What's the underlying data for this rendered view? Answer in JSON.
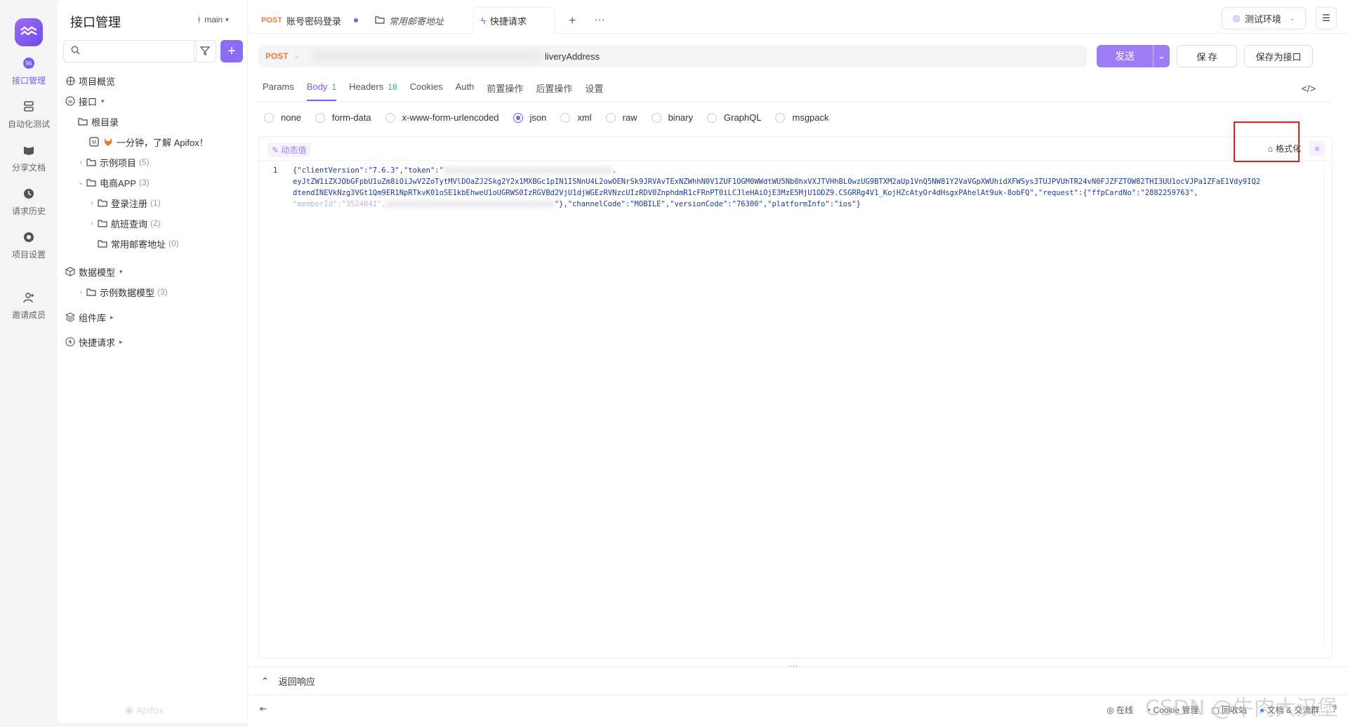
{
  "rail": {
    "items": [
      {
        "label": "接口管理",
        "icon": "api-icon"
      },
      {
        "label": "自动化测试",
        "icon": "automation-icon"
      },
      {
        "label": "分享文档",
        "icon": "book-icon"
      },
      {
        "label": "请求历史",
        "icon": "clock-icon"
      },
      {
        "label": "项目设置",
        "icon": "settings-icon"
      },
      {
        "label": "邀请成员",
        "icon": "add-user-icon"
      }
    ]
  },
  "sidebar": {
    "title": "接口管理",
    "branch": "main",
    "search_placeholder": "",
    "tree": [
      {
        "label": "项目概览"
      },
      {
        "label": "接口"
      },
      {
        "label": "根目录"
      },
      {
        "label": "一分钟，了解 Apifox！"
      },
      {
        "label": "示例项目",
        "count": "(5)"
      },
      {
        "label": "电商APP",
        "count": "(3)"
      },
      {
        "label": "登录注册",
        "count": "(1)"
      },
      {
        "label": "航班查询",
        "count": "(2)"
      },
      {
        "label": "常用邮寄地址",
        "count": "(0)"
      },
      {
        "label": "数据模型"
      },
      {
        "label": "示例数据模型",
        "count": "(3)"
      },
      {
        "label": "组件库"
      },
      {
        "label": "快捷请求"
      }
    ],
    "footer": "Apifox"
  },
  "tabs": [
    {
      "method": "POST",
      "label": "账号密码登录"
    },
    {
      "label": "常用邮寄地址"
    },
    {
      "label": "快捷请求"
    }
  ],
  "env": "测试环境",
  "request": {
    "method": "POST",
    "url_visible": "liveryAddress",
    "send": "发送",
    "save": "保 存",
    "save_as": "保存为接口"
  },
  "req_tabs": [
    {
      "label": "Params"
    },
    {
      "label": "Body",
      "badge": "1"
    },
    {
      "label": "Headers",
      "badge": "18"
    },
    {
      "label": "Cookies"
    },
    {
      "label": "Auth"
    },
    {
      "label": "前置操作"
    },
    {
      "label": "后置操作"
    },
    {
      "label": "设置"
    }
  ],
  "body_types": [
    "none",
    "form-data",
    "x-www-form-urlencoded",
    "json",
    "xml",
    "raw",
    "binary",
    "GraphQL",
    "msgpack"
  ],
  "selected_body_type": "json",
  "editor": {
    "dynamic_value": "动态值",
    "format": "格式化",
    "line_number": "1",
    "line1_a": "{\"clientVersion\":\"7.6.3\",\"token\":\"",
    "line1_b": ".",
    "line2": "eyJtZW1iZXJObGFpbU1uZm8iOiJwV2ZoTytMVlDOaZJ2Skg2Y2x1MXBGc1pIN1ISNnU4L2owOENrSk9JRVAvTExNZWhhN0V1ZUF1OGM0WWdtWU5Nb0hxVXJTVHhBL0wzUG9BTXM2aUp1VnQ5NW81Y2VaVGpXWUhidXFWSys3TUJPVUhTR24vN0FJZFZTOW82THI3UU1ocVJPa1ZFaE1Vdy9IQ2",
    "line3": "dtendINEVkNzg3VGt1Qm9ER1NpRTkvK01oSE1kbEhweU1oUGRWS0IzRGVBd2VjU1djWGEzRVNzcUIzRDV0ZnphdmR1cFRnPT0iLCJleHAiOjE3MzE5MjU1ODZ9.CSGRRg4V1_KojHZcAtyOr4dHsgxPAhelAt9uk-8obFQ\",\"request\":{\"ffpCardNo\":\"2882259763\",",
    "line4_a": "\"memberId\":\"3524041\",",
    "line4_b": "\"},\"channelCode\":\"MOBILE\",\"versionCode\":\"76300\",\"platformInfo\":\"ios\"}"
  },
  "response": {
    "label": "返回响应"
  },
  "status_bar": {
    "online": "在线",
    "cookie": "Cookie 管理",
    "recycle": "回收站",
    "docs": "文档 & 交流群"
  },
  "watermark": "CSDN @牛肉大汉堡"
}
